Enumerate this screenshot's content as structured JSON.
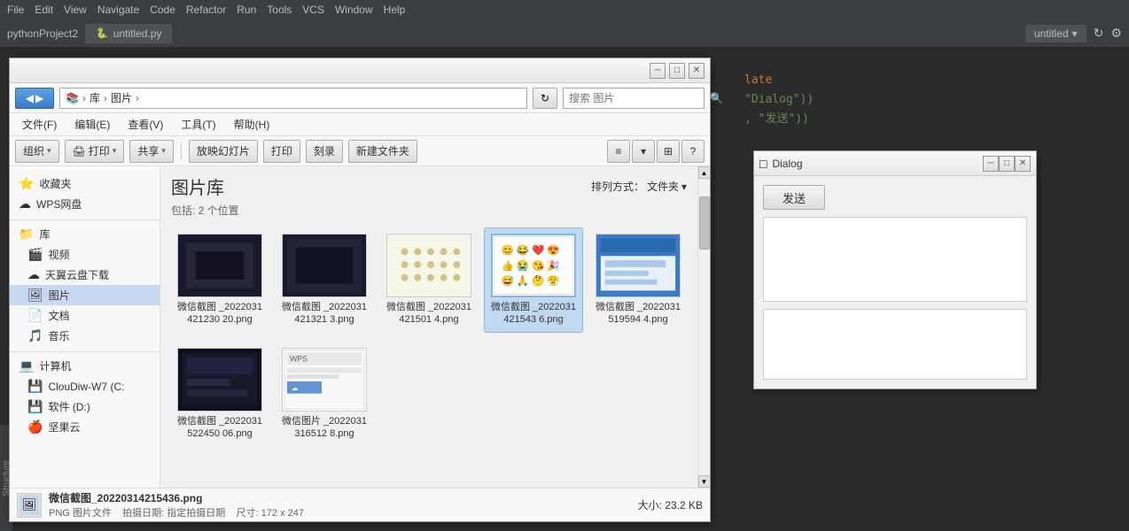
{
  "ide": {
    "menubar": {
      "items": [
        "File",
        "Edit",
        "View",
        "Navigate",
        "Code",
        "Refactor",
        "Run",
        "Tools",
        "VCS",
        "Window",
        "Help"
      ]
    },
    "project_label": "pythonProject2",
    "tab": {
      "icon": "🐍",
      "label": "untitled.py"
    },
    "top_right": {
      "untitled_label": "untitled",
      "arrow": "▾",
      "refresh_icon": "↻",
      "settings_icon": "⚙"
    },
    "code_lines": [
      "late",
      "\"Dialog\"))",
      ",  \"发送\"))"
    ]
  },
  "file_explorer": {
    "title": "",
    "titlebar_btns": {
      "minimize": "─",
      "maximize": "□",
      "close": "✕"
    },
    "addressbar": {
      "back_label": "◀",
      "forward_label": "▶",
      "path_parts": [
        "库",
        "图片"
      ],
      "refresh": "↻",
      "search_placeholder": "搜索 图片"
    },
    "menubar": {
      "items": [
        "文件(F)",
        "编辑(E)",
        "查看(V)",
        "工具(T)",
        "帮助(H)"
      ]
    },
    "toolbar": {
      "organize": "组织",
      "open": "打印",
      "open_arrow": "▾",
      "share": "共享",
      "share_arrow": "▾",
      "slideshow": "放映幻灯片",
      "print": "打印",
      "burn": "刻录",
      "new_folder": "新建文件夹"
    },
    "sidebar": {
      "sections": [
        {
          "items": [
            {
              "icon": "⭐",
              "label": "收藏夹"
            },
            {
              "icon": "☁",
              "label": "WPS网盘"
            }
          ]
        },
        {
          "items": [
            {
              "icon": "📁",
              "label": "库"
            },
            {
              "icon": "🎬",
              "label": "视频"
            },
            {
              "icon": "☁",
              "label": "天翼云盘下载"
            },
            {
              "icon": "🖼",
              "label": "图片",
              "selected": true
            },
            {
              "icon": "📄",
              "label": "文档"
            },
            {
              "icon": "🎵",
              "label": "音乐"
            }
          ]
        },
        {
          "items": [
            {
              "icon": "💻",
              "label": "计算机"
            },
            {
              "icon": "💾",
              "label": "ClouDiw-W7 (C:"
            },
            {
              "icon": "💾",
              "label": "软件 (D:)"
            },
            {
              "icon": "🍎",
              "label": "坚果云"
            }
          ]
        }
      ]
    },
    "library": {
      "title": "图片库",
      "subtitle": "包括: 2 个位置",
      "sort_label": "排列方式：",
      "sort_value": "文件夹",
      "sort_arrow": "▾"
    },
    "files": [
      {
        "id": "file1",
        "name": "微信截图\n_2022031421230\n20.png",
        "thumb_type": "movie",
        "selected": false
      },
      {
        "id": "file2",
        "name": "微信截图\n_2022031421321\n3.png",
        "thumb_type": "movie2",
        "selected": false
      },
      {
        "id": "file3",
        "name": "微信截图\n_2022031421501\n4.png",
        "thumb_type": "dots",
        "selected": false
      },
      {
        "id": "file4",
        "name": "微信截图\n_2022031421543\n6.png",
        "thumb_type": "emoji",
        "selected": true
      },
      {
        "id": "file5",
        "name": "微信截图\n_2022031519594\n4.png",
        "thumb_type": "blue",
        "selected": false
      },
      {
        "id": "file6",
        "name": "微信截图\n_2022031522450\n06.png",
        "thumb_type": "wechat",
        "selected": false
      },
      {
        "id": "file7",
        "name": "微信图片\n_2022031316512\n8.png",
        "thumb_type": "wps",
        "selected": false
      }
    ],
    "statusbar": {
      "filename": "微信截图_20220314215436.png",
      "date_label": "拍摄日期:",
      "date_value": "指定拍摄日期",
      "size_label": "大小:",
      "size_value": "23.2 KB",
      "type": "PNG 图片文件",
      "dimensions_label": "尺寸:",
      "dimensions_value": "172 x 247"
    }
  },
  "dialog": {
    "title": "Dialog",
    "icon": "□",
    "btns": {
      "minimize": "─",
      "maximize": "□",
      "close": "✕"
    },
    "send_btn": "发送"
  }
}
